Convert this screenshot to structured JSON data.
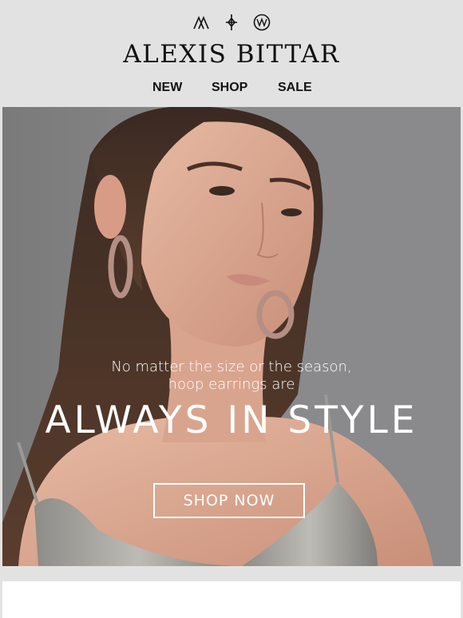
{
  "header": {
    "brand": "ALEXIS BITTAR",
    "icons": [
      "triangle-mark-icon",
      "diamond-cross-icon",
      "circle-emblem-icon"
    ]
  },
  "nav": {
    "items": [
      {
        "label": "NEW"
      },
      {
        "label": "SHOP"
      },
      {
        "label": "SALE"
      }
    ]
  },
  "hero": {
    "subtitle_line1": "No matter the size or the season,",
    "subtitle_line2": "hoop earrings are",
    "title": "ALWAYS IN STYLE",
    "cta_label": "SHOP NOW",
    "image_alt": "Model wearing large hoop earrings and a silver sequin top"
  },
  "colors": {
    "background": "#e3e2e2",
    "hero_gray": "#858587",
    "text_dark": "#111111",
    "text_light": "#ffffff"
  }
}
